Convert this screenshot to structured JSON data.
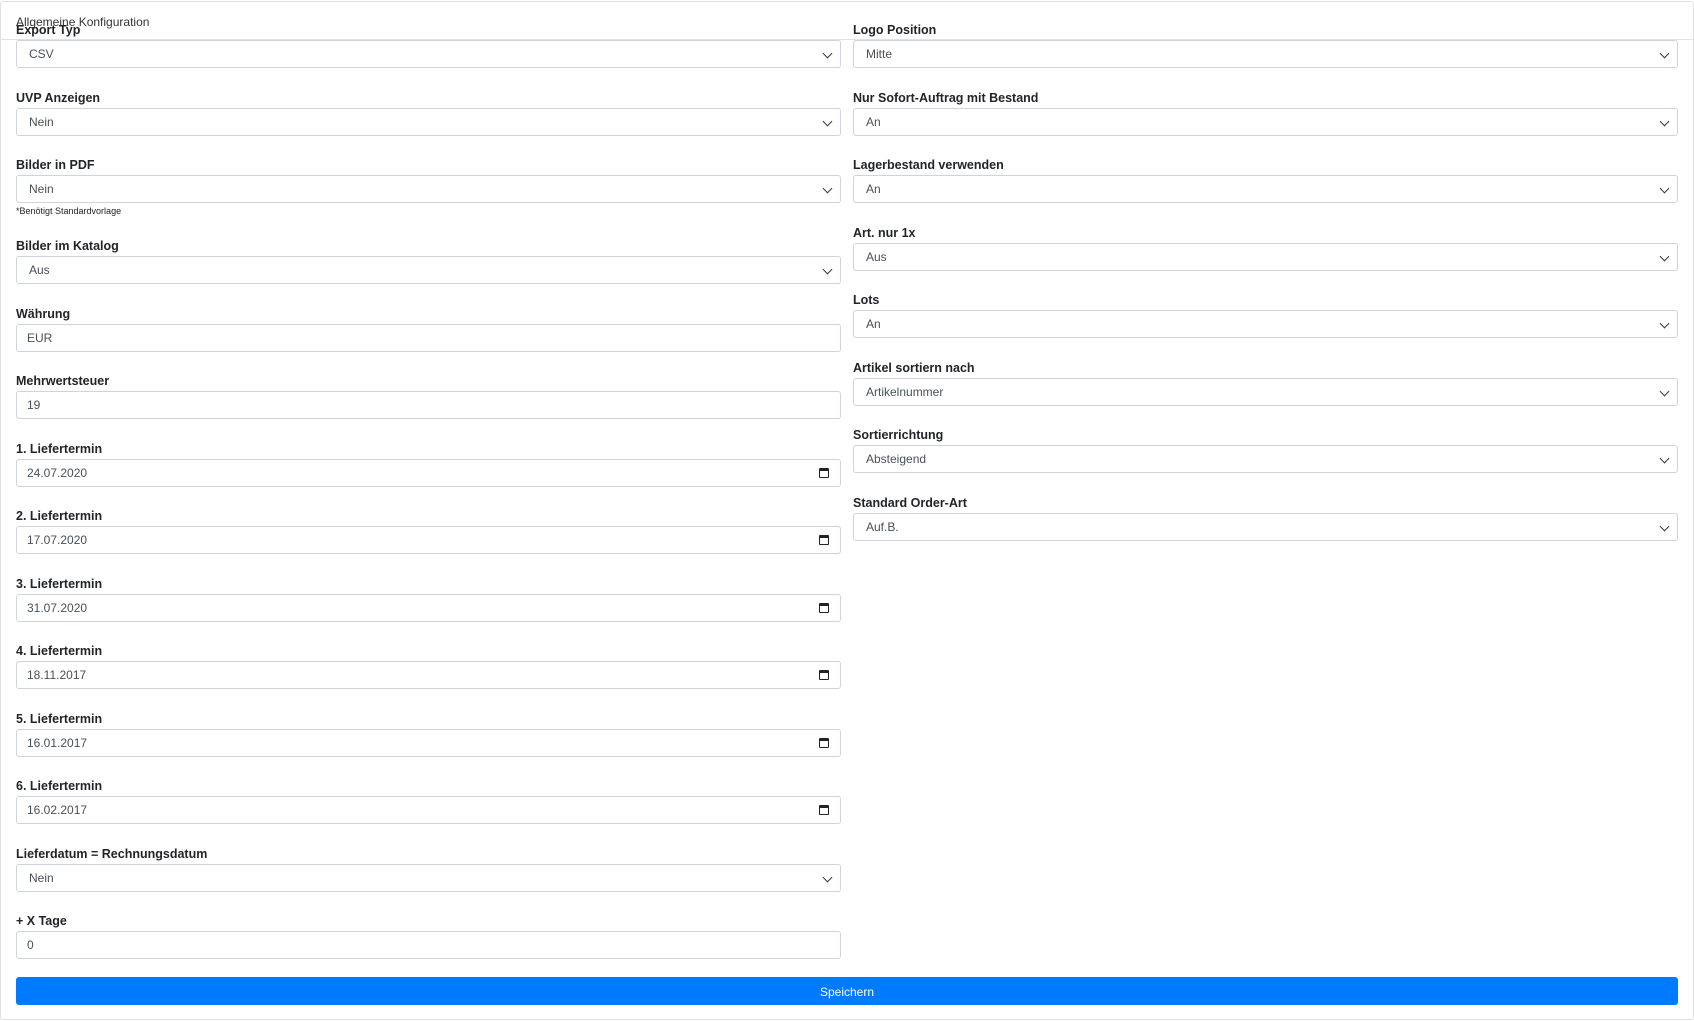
{
  "header": {
    "title": "Allgemeine Konfiguration"
  },
  "left": {
    "export_typ": {
      "label": "Export Typ",
      "value": "CSV"
    },
    "uvp": {
      "label": "UVP Anzeigen",
      "value": "Nein"
    },
    "bilder_pdf": {
      "label": "Bilder in PDF",
      "value": "Nein",
      "hint": "*Benötigt Standardvorlage"
    },
    "bilder_katalog": {
      "label": "Bilder im Katalog",
      "value": "Aus"
    },
    "waehrung": {
      "label": "Währung",
      "value": "EUR"
    },
    "mwst": {
      "label": "Mehrwertsteuer",
      "value": "19"
    },
    "liefer1": {
      "label": "1. Liefertermin",
      "value": "24.07.2020"
    },
    "liefer2": {
      "label": "2. Liefertermin",
      "value": "17.07.2020"
    },
    "liefer3": {
      "label": "3. Liefertermin",
      "value": "31.07.2020"
    },
    "liefer4": {
      "label": "4. Liefertermin",
      "value": "18.11.2017"
    },
    "liefer5": {
      "label": "5. Liefertermin",
      "value": "16.01.2017"
    },
    "liefer6": {
      "label": "6. Liefertermin",
      "value": "16.02.2017"
    },
    "lieferdatum_rechnung": {
      "label": "Lieferdatum = Rechnungsdatum",
      "value": "Nein"
    },
    "x_tage": {
      "label": "+ X Tage",
      "value": "0"
    }
  },
  "right": {
    "logo_position": {
      "label": "Logo Position",
      "value": "Mitte"
    },
    "sofort_auftrag": {
      "label": "Nur Sofort-Auftrag mit Bestand",
      "value": "An"
    },
    "lagerbestand": {
      "label": "Lagerbestand verwenden",
      "value": "An"
    },
    "art_nur_1x": {
      "label": "Art. nur 1x",
      "value": "Aus"
    },
    "lots": {
      "label": "Lots",
      "value": "An"
    },
    "artikel_sortierung": {
      "label": "Artikel sortiern nach",
      "value": "Artikelnummer"
    },
    "sortierrichtung": {
      "label": "Sortierrichtung",
      "value": "Absteigend"
    },
    "standard_order_art": {
      "label": "Standard Order-Art",
      "value": "Auf.B."
    }
  },
  "actions": {
    "save_label": "Speichern"
  },
  "colors": {
    "primary": "#007bff",
    "border": "#ced4da"
  },
  "icons": {
    "select": "chevron-down-icon",
    "date": "calendar-icon"
  }
}
